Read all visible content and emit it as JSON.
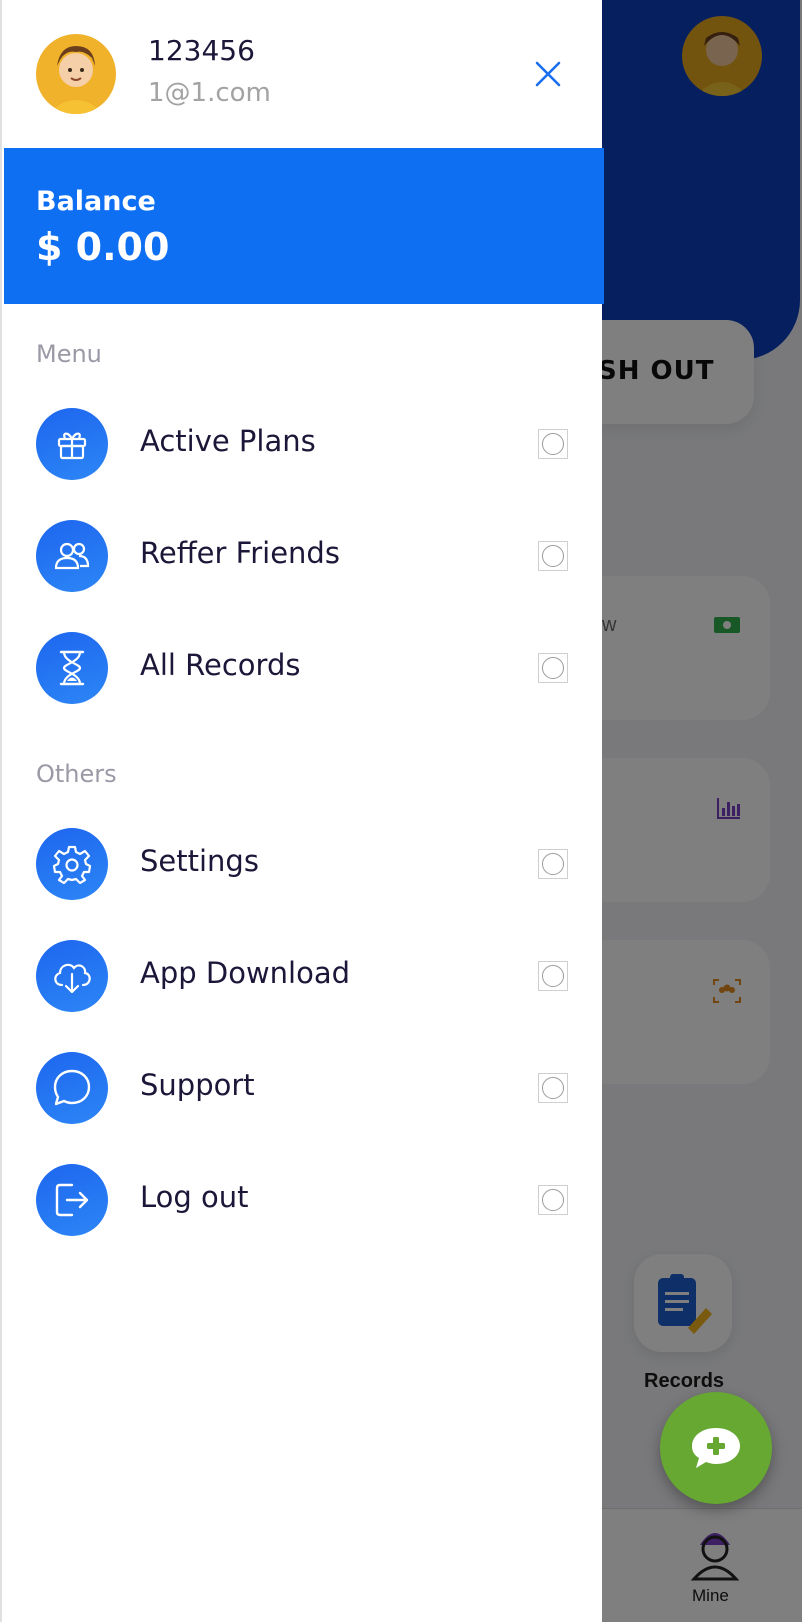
{
  "background": {
    "cashout_label": "SH OUT",
    "card_1_label": "w",
    "records_label": "Records",
    "nav_mine_label": "Mine"
  },
  "drawer": {
    "profile": {
      "username": "123456",
      "email": "1@1.com"
    },
    "balance": {
      "label": "Balance",
      "amount": "$ 0.00"
    },
    "sections": {
      "menu_title": "Menu",
      "others_title": "Others"
    },
    "menu_items": [
      {
        "label": "Active Plans",
        "icon": "gift-icon"
      },
      {
        "label": "Reffer Friends",
        "icon": "users-icon"
      },
      {
        "label": "All Records",
        "icon": "hourglass-icon"
      }
    ],
    "other_items": [
      {
        "label": "Settings",
        "icon": "gear-icon"
      },
      {
        "label": "App Download",
        "icon": "cloud-download-icon"
      },
      {
        "label": "Support",
        "icon": "chat-bubble-icon"
      },
      {
        "label": "Log out",
        "icon": "logout-icon"
      }
    ]
  },
  "colors": {
    "accent": "#0f6ff2",
    "icon_bg": "#1e66ef",
    "text_dark": "#1c1738",
    "fab": "#66a832"
  }
}
